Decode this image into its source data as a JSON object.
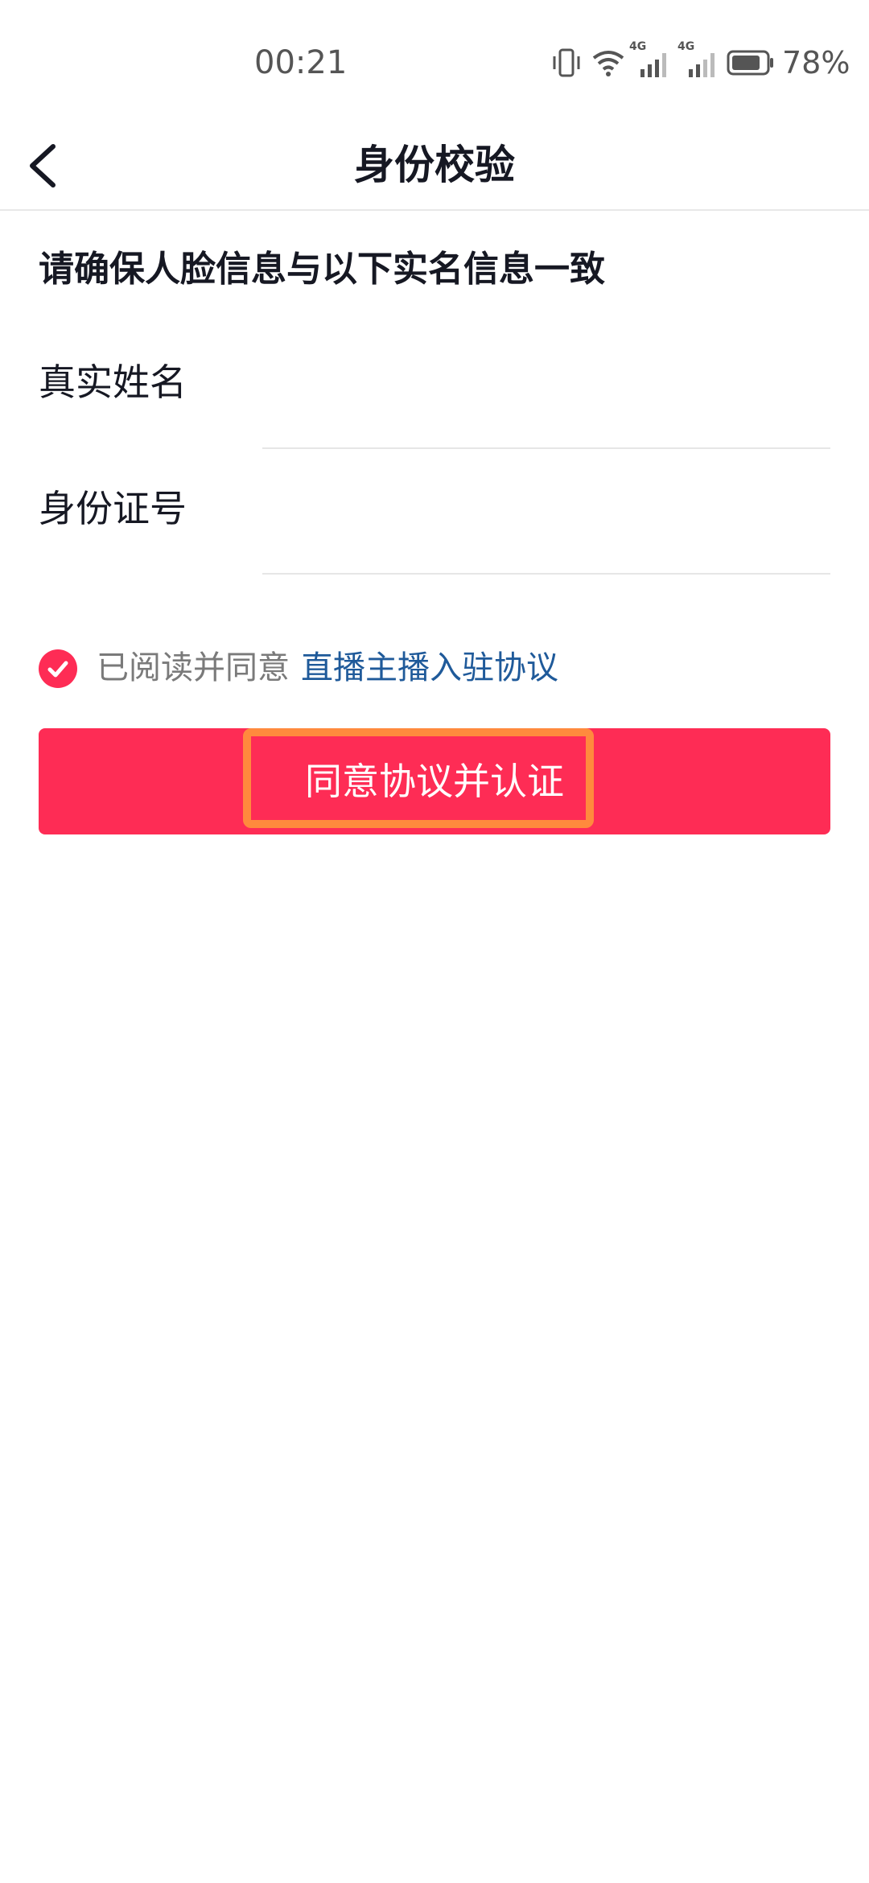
{
  "status_bar": {
    "time": "00:21",
    "battery": "78%",
    "network_1": "4G",
    "network_2": "4G"
  },
  "header": {
    "title": "身份校验",
    "back_icon": "chevron-left-icon"
  },
  "form": {
    "notice": "请确保人脸信息与以下实名信息一致",
    "name_label": "真实姓名",
    "name_value": "",
    "id_label": "身份证号",
    "id_value": ""
  },
  "agreement": {
    "checked": true,
    "prefix": "已阅读并同意",
    "link": "直播主播入驻协议"
  },
  "actions": {
    "submit_label": "同意协议并认证"
  },
  "colors": {
    "accent": "#fe2c55",
    "link": "#1f5a9a",
    "highlight": "#ff8a3d"
  }
}
